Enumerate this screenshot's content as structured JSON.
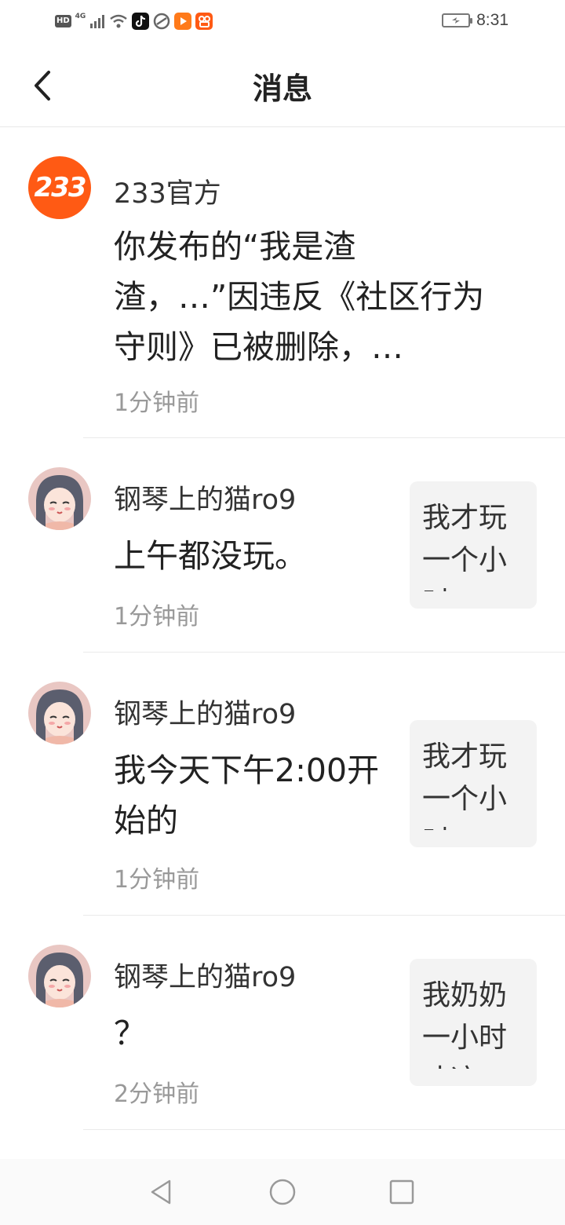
{
  "status_bar": {
    "hd": "HD",
    "network": "4G",
    "time": "8:31",
    "icons": [
      "signal-icon",
      "wifi-icon",
      "tiktok-icon",
      "browser-icon",
      "video-app-icon",
      "kuaishou-icon",
      "battery-charging-icon"
    ]
  },
  "header": {
    "title": "消息",
    "back_icon": "chevron-left-icon"
  },
  "messages": [
    {
      "sender": "233官方",
      "text": "你发布的“我是渣渣，…”因违反《社区行为守则》已被删除，…",
      "time": "1分钟前",
      "avatar": "233-logo",
      "avatar_text": "233"
    },
    {
      "sender": "钢琴上的猫ro9",
      "text": "上午都没玩。",
      "time": "1分钟前",
      "avatar": "anime-girl-avatar",
      "quote": "我才玩一个小时"
    },
    {
      "sender": "钢琴上的猫ro9",
      "text": "我今天下午2:00开始的",
      "time": "1分钟前",
      "avatar": "anime-girl-avatar",
      "quote": "我才玩一个小时"
    },
    {
      "sender": "钢琴上的猫ro9",
      "text": "？",
      "time": "2分钟前",
      "avatar": "anime-girl-avatar",
      "quote": "我奶奶一小时才这"
    }
  ],
  "nav_bar": {
    "items": [
      "back-triangle-icon",
      "home-circle-icon",
      "recents-square-icon"
    ]
  },
  "colors": {
    "brand_orange": "#ff5a14",
    "time_gray": "#999999",
    "quote_bg": "#f3f3f3"
  }
}
